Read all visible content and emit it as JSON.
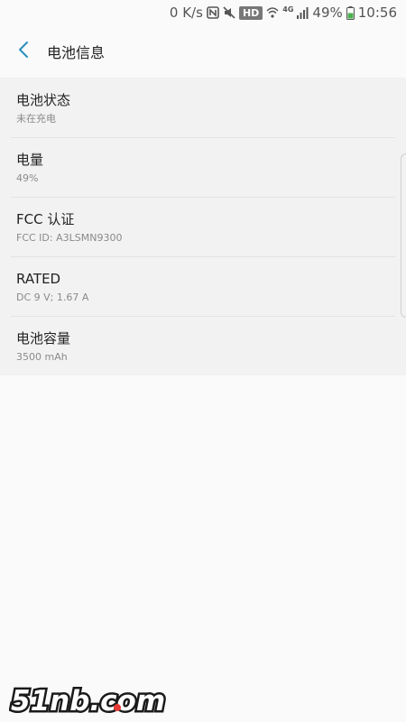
{
  "status_bar": {
    "speed": "0 K/s",
    "hd": "HD",
    "network": "4G",
    "battery_percent": "49%",
    "time": "10:56"
  },
  "header": {
    "title": "电池信息"
  },
  "items": [
    {
      "title": "电池状态",
      "subtitle": "未在充电"
    },
    {
      "title": "电量",
      "subtitle": "49%"
    },
    {
      "title": "FCC 认证",
      "subtitle": "FCC ID: A3LSMN9300"
    },
    {
      "title": "RATED",
      "subtitle": "DC 9 V; 1.67 A"
    },
    {
      "title": "电池容量",
      "subtitle": "3500 mAh"
    }
  ],
  "watermark": "51nb.com",
  "colors": {
    "accent": "#2a8fbd",
    "battery": "#4caf50",
    "watermark_red": "#e53935"
  }
}
